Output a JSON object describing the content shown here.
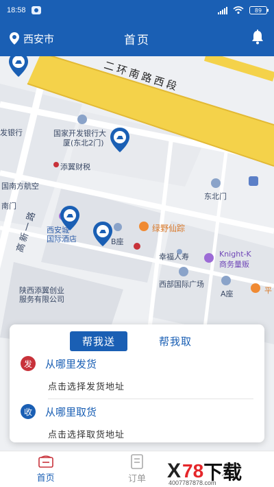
{
  "status_bar": {
    "time": "18:58",
    "battery": "89"
  },
  "header": {
    "city": "西安市",
    "title": "首页"
  },
  "map": {
    "labels": [
      {
        "text": "二环南路西段",
        "kind": "road"
      },
      {
        "text": "发银行"
      },
      {
        "text": "国家开发银行大"
      },
      {
        "text": "厦(东北2门)"
      },
      {
        "text": "添翼财税"
      },
      {
        "text": "国南方航空"
      },
      {
        "text": "南门"
      },
      {
        "text": "东北门"
      },
      {
        "text": "西安城"
      },
      {
        "text": "国际酒店"
      },
      {
        "text": "B座"
      },
      {
        "text": "绿野仙踪"
      },
      {
        "text": "幸福人寿"
      },
      {
        "text": "Knight-K"
      },
      {
        "text": "商务量贩"
      },
      {
        "text": "陕西添翼创业"
      },
      {
        "text": "服务有限公司"
      },
      {
        "text": "西部国际广场"
      },
      {
        "text": "A座"
      },
      {
        "text": "高新一路"
      },
      {
        "text": "平"
      }
    ]
  },
  "service_card": {
    "tabs": [
      "帮我送",
      "帮我取"
    ],
    "active_tab": 0,
    "send": {
      "badge": "发",
      "title": "从哪里发货",
      "hint": "点击选择发货地址"
    },
    "receive": {
      "badge": "收",
      "title": "从哪里取货",
      "hint": "点击选择取货地址"
    }
  },
  "tab_bar": {
    "items": [
      "首页",
      "订单"
    ],
    "active": 0
  },
  "watermark": {
    "logo_x": "X",
    "logo_num": "78",
    "logo_text": "下载",
    "url": "4007787878.com"
  },
  "colors": {
    "primary": "#1a5fb4",
    "send_badge": "#c8323a",
    "road": "#f4d24a"
  }
}
